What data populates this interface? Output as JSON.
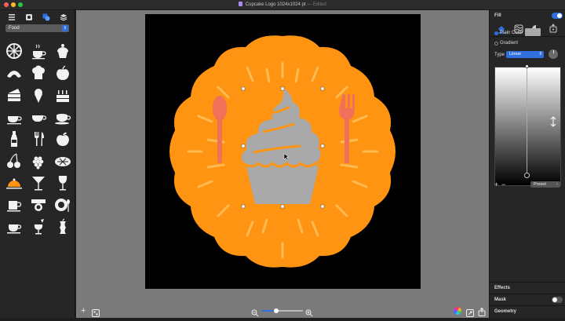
{
  "window": {
    "title": "Cupcake Logo 1024x1024 pt",
    "status": "— Edited",
    "traffic_lights": [
      "#ff5f57",
      "#febc2e",
      "#28c840"
    ]
  },
  "sidebar": {
    "tabs": [
      "list-icon",
      "library-icon",
      "shapes-icon",
      "layers-icon"
    ],
    "category": "Food",
    "grid_icons": [
      "orange-slice-icon",
      "hot-tea-icon",
      "cupcake-icon",
      "croissant-icon",
      "chef-hat-icon",
      "apple-icon",
      "cake-slice-icon",
      "ice-cream-icon",
      "birthday-cake-icon",
      "coffee-cup-icon",
      "teacup-icon",
      "espresso-icon",
      "bottle-icon",
      "fork-knife-icon",
      "apple-alt-icon",
      "cherries-icon",
      "grapes-icon",
      "pie-icon",
      "serving-cloche-icon",
      "cocktail-icon",
      "wine-glass-icon",
      "mug-icon",
      "table-setting-icon",
      "plate-spoon-icon",
      "coffee-saucer-icon",
      "wine-pour-icon",
      "apple-core-icon"
    ]
  },
  "canvas": {
    "bg_color": "#000000",
    "badge_color": "#ff9312",
    "cupcake_color": "#a9a9a9",
    "utensil_color": "#f0705a",
    "ray_color": "#ffc15c"
  },
  "bottom_bar": {
    "zoom_level": 0.35
  },
  "inspector": {
    "section_fill": "Fill",
    "fill_modes": [
      "fill-bucket-icon",
      "pattern-icon",
      "mask-icon",
      "pen-tool-icon"
    ],
    "plain_color_label": "Plain Color",
    "plain_color_value": "#a9a9a9",
    "gradient_label": "Gradient",
    "type_label": "Type",
    "type_value": "Linear",
    "add_label": "+",
    "remove_label": "−",
    "preset_label": "Preset",
    "effects_label": "Effects",
    "mask_label": "Mask",
    "geometry_label": "Geometry"
  }
}
